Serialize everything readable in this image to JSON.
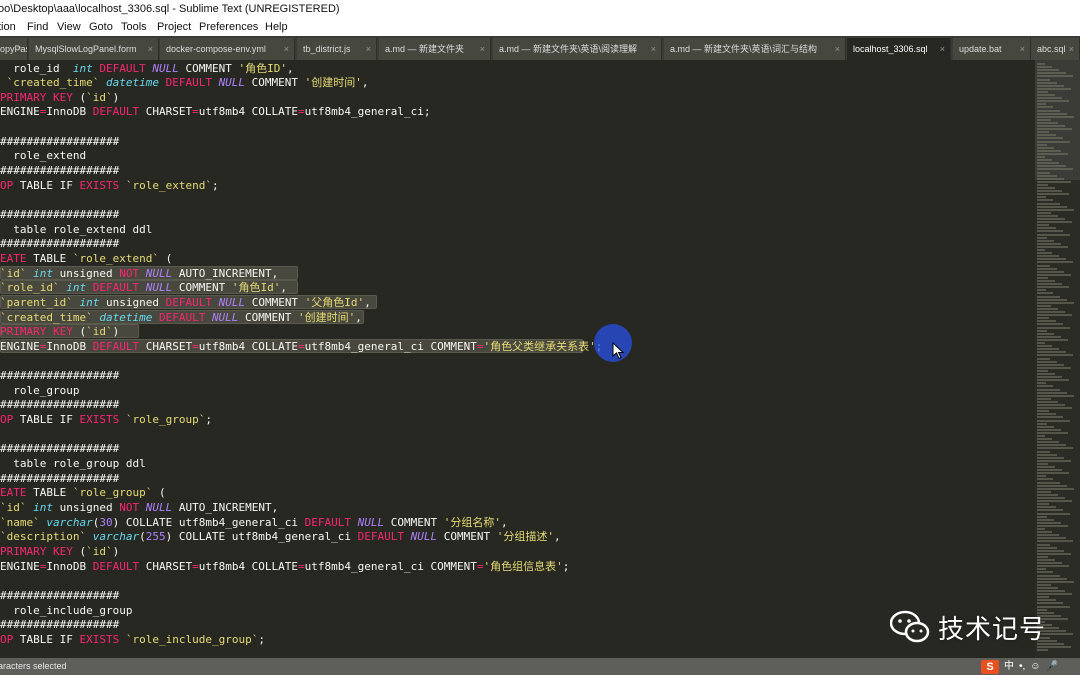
{
  "window": {
    "title": "oo\\Desktop\\aaa\\localhost_3306.sql - Sublime Text (UNREGISTERED)"
  },
  "menu": [
    "tion",
    "Find",
    "View",
    "Goto",
    "Tools",
    "Project",
    "Preferences",
    "Help"
  ],
  "tabs": [
    {
      "label": "opyPast"
    },
    {
      "label": "MysqlSlowLogPanel.form"
    },
    {
      "label": "docker-compose-env.yml"
    },
    {
      "label": "tb_district.js"
    },
    {
      "label": "a.md — 新建文件夹"
    },
    {
      "label": "a.md — 新建文件夹\\英语\\阅读理解"
    },
    {
      "label": "a.md — 新建文件夹\\英语\\词汇与结构"
    },
    {
      "label": "localhost_3306.sql",
      "active": true
    },
    {
      "label": "update.bat"
    },
    {
      "label": "abc.sql"
    }
  ],
  "code_lines": [
    "  role_id  int DEFAULT NULL COMMENT '角色ID',",
    " `created_time` datetime DEFAULT NULL COMMENT '创建时间',",
    "PRIMARY KEY (`id`)",
    "ENGINE=InnoDB DEFAULT CHARSET=utf8mb4 COLLATE=utf8mb4_general_ci;",
    "",
    "##################",
    "  role_extend",
    "##################",
    "OP TABLE IF EXISTS `role_extend`;",
    "",
    "##################",
    "  table role_extend ddl",
    "##################",
    "EATE TABLE `role_extend` (",
    "`id` int unsigned NOT NULL AUTO_INCREMENT,",
    "`role_id` int DEFAULT NULL COMMENT '角色Id',",
    "`parent_id` int unsigned DEFAULT NULL COMMENT '父角色Id',",
    "`created_time` datetime DEFAULT NULL COMMENT '创建时间',",
    "PRIMARY KEY (`id`)",
    "ENGINE=InnoDB DEFAULT CHARSET=utf8mb4 COLLATE=utf8mb4_general_ci COMMENT='角色父类继承关系表';",
    "",
    "##################",
    "  role_group",
    "##################",
    "OP TABLE IF EXISTS `role_group`;",
    "",
    "##################",
    "  table role_group ddl",
    "##################",
    "EATE TABLE `role_group` (",
    "`id` int unsigned NOT NULL AUTO_INCREMENT,",
    "`name` varchar(30) COLLATE utf8mb4_general_ci DEFAULT NULL COMMENT '分组名称',",
    "`description` varchar(255) COLLATE utf8mb4_general_ci DEFAULT NULL COMMENT '分组描述',",
    "PRIMARY KEY (`id`)",
    "ENGINE=InnoDB DEFAULT CHARSET=utf8mb4 COLLATE=utf8mb4_general_ci COMMENT='角色组信息表';",
    "",
    "##################",
    "  role_include_group",
    "##################",
    "OP TABLE IF EXISTS `role_include_group`;"
  ],
  "selected_lines": [
    14,
    15,
    16,
    17,
    18,
    19
  ],
  "status": {
    "text": "aracters selected"
  },
  "ime": {
    "logo": "S",
    "lang": "中"
  },
  "watermark": {
    "text": "技术记号"
  },
  "colors": {
    "background": "#272822",
    "keyword": "#f92672",
    "string": "#e6db74",
    "type": "#66d9ef",
    "constant": "#ae81ff",
    "text": "#f8f8f2",
    "cursor_highlight": "#2850e6",
    "ime_logo": "#e8501f"
  }
}
